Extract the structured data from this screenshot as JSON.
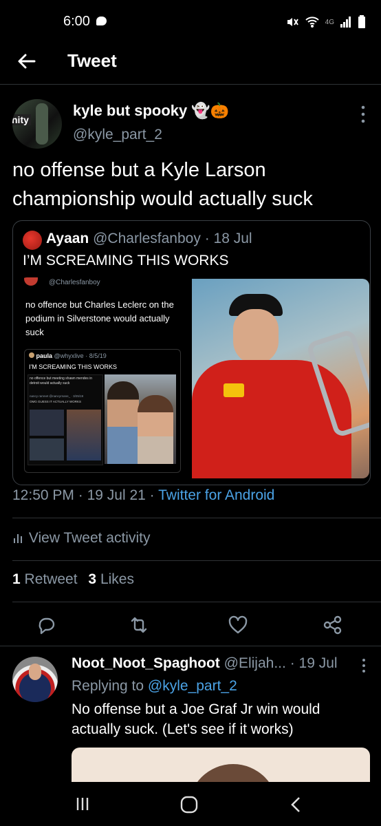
{
  "status_bar": {
    "time": "6:00",
    "network": "4G"
  },
  "header": {
    "title": "Tweet"
  },
  "tweet": {
    "display_name": "kyle but spooky 👻🎃",
    "handle": "@kyle_part_2",
    "text": "no offense but a Kyle Larson championship would actually suck",
    "time": "12:50 PM",
    "date": "19 Jul 21",
    "source": "Twitter for Android",
    "activity_label": "View Tweet activity",
    "retweets": {
      "count": "1",
      "label": "Retweet"
    },
    "likes": {
      "count": "3",
      "label": "Likes"
    },
    "avatar_text": "nity"
  },
  "quote": {
    "display_name": "Ayaan",
    "handle": "@Charlesfanboy",
    "date": "· 18 Jul",
    "text": "I’M SCREAMING THIS WORKS",
    "inner": {
      "handle": "@Charlesfanboy",
      "text": "no offence but Charles Leclerc on the podium in Silverstone would actually suck",
      "nested_name": "paula",
      "nested_handle": "@whyxlive · 8/5/19",
      "nested_text": "I'M SCREAMING THIS WORKS",
      "deep_text": "no offence but meeting shawn mendes in detroit would actually suck",
      "deep_name": "nancy ramnet",
      "deep_handle": "@nancyrnane_ · 3/25/19",
      "deep_caption": "OMG GUESS IT ACTUALLY WORKS"
    }
  },
  "reply": {
    "display_name": "Noot_Noot_Spaghoot",
    "handle": "@Elijah...",
    "date": "· 19 Jul",
    "replying_label": "Replying to",
    "replying_to": "@kyle_part_2",
    "text": "No offense but a Joe Graf Jr win would actually suck. (Let's see if it works)"
  },
  "colors": {
    "background": "#000000",
    "link": "#4ba3e6",
    "muted": "#8b98a5",
    "border": "#2f3336"
  }
}
